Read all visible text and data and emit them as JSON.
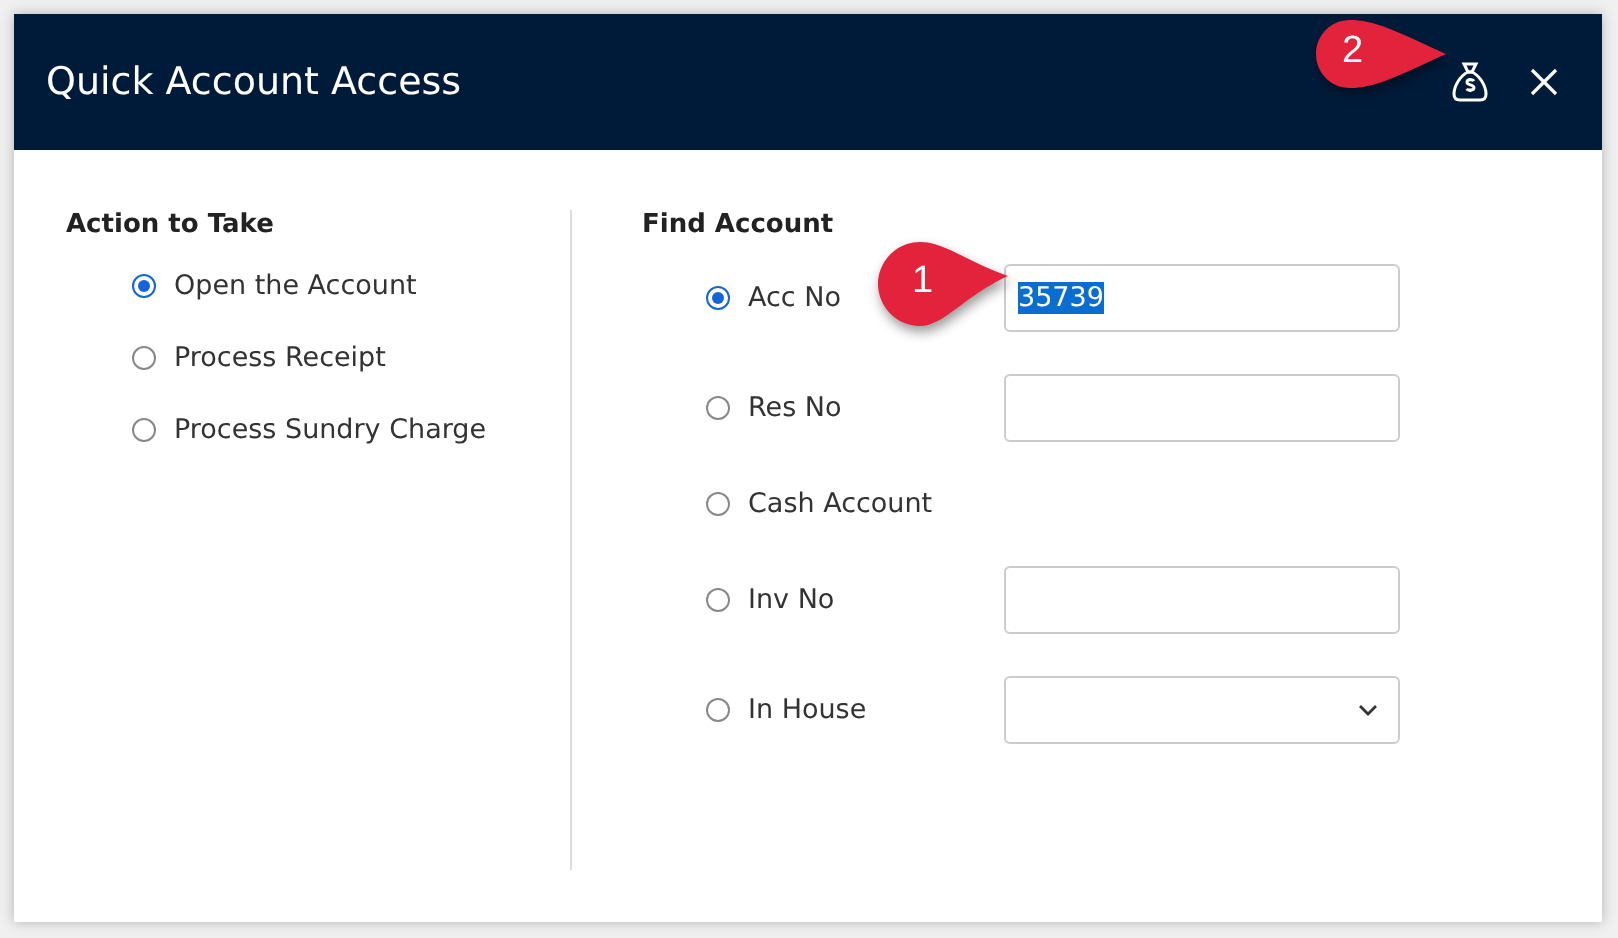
{
  "window": {
    "title": "Quick Account Access"
  },
  "header_callout": {
    "number": "2"
  },
  "action": {
    "heading": "Action to Take",
    "options": [
      {
        "label": "Open the Account",
        "selected": true
      },
      {
        "label": "Process Receipt",
        "selected": false
      },
      {
        "label": "Process Sundry Charge",
        "selected": false
      }
    ]
  },
  "find": {
    "heading": "Find Account",
    "options": [
      {
        "label": "Acc No",
        "selected": true,
        "kind": "field",
        "value": "35739",
        "value_selected": true,
        "callout": "1"
      },
      {
        "label": "Res No",
        "selected": false,
        "kind": "field"
      },
      {
        "label": "Cash Account",
        "selected": false,
        "kind": "none"
      },
      {
        "label": "Inv No",
        "selected": false,
        "kind": "field"
      },
      {
        "label": "In House",
        "selected": false,
        "kind": "select"
      }
    ]
  }
}
